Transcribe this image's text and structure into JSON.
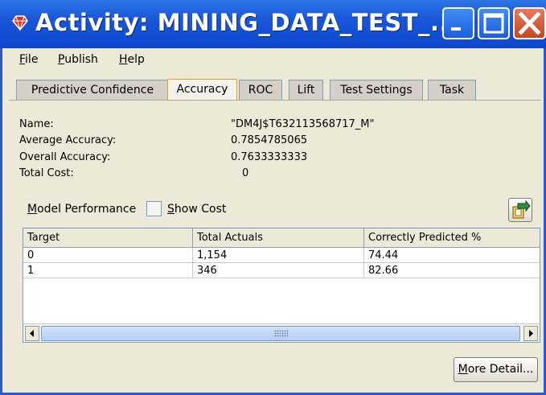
{
  "window": {
    "title": "Activity: MINING_DATA_TEST_...",
    "icon": "mining-activity-icon",
    "title_bar_color": "#1956d9",
    "controls": [
      "minimize-icon",
      "maximize-icon",
      "close-icon"
    ]
  },
  "menu": {
    "file": "File",
    "publish": "Publish",
    "help": "Help"
  },
  "tabs": {
    "predictive_confidence": "Predictive Confidence",
    "accuracy": "Accuracy",
    "roc": "ROC",
    "lift": "Lift",
    "test_settings": "Test Settings",
    "task": "Task",
    "active": "Accuracy",
    "active_color": "#e3a21a"
  },
  "info": {
    "name_label": "Name:",
    "name_value": "\"DM4J$T632113568717_M\"",
    "avg_label": "Average Accuracy:",
    "avg_value": "0.7854785065",
    "overall_label": "Overall Accuracy:",
    "overall_value": "0.7633333333",
    "cost_label": "Total Cost:",
    "cost_value": "0"
  },
  "controls": {
    "model_performance": "Model Performance",
    "show_cost": "Show Cost",
    "show_cost_checked": false,
    "export_icon": "export-icon",
    "more_detail": "More Detail..."
  },
  "table": {
    "columns": [
      "Target",
      "Total Actuals",
      "Correctly Predicted %"
    ],
    "rows": [
      [
        "0",
        "1,154",
        "74.44"
      ],
      [
        "1",
        "346",
        "82.66"
      ]
    ]
  }
}
